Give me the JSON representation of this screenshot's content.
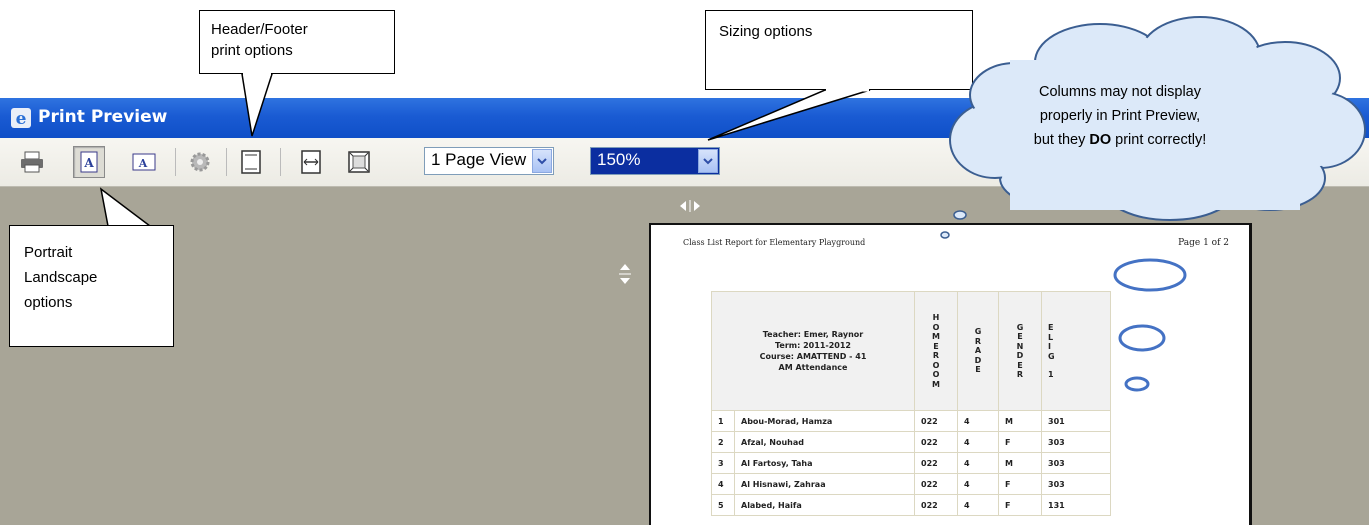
{
  "window": {
    "title": "Print Preview"
  },
  "toolbar": {
    "page_view_select": "1 Page View",
    "zoom_select": "150%"
  },
  "callouts": {
    "header_footer": [
      "Header/Footer",
      "print options"
    ],
    "sizing": "Sizing options",
    "portrait_landscape": [
      "Portrait",
      "Landscape",
      "options"
    ],
    "cloud": {
      "line1": "Columns may not display",
      "line2": "properly in Print Preview,",
      "line3_pre": "but they ",
      "line3_bold": "DO",
      "line3_post": " print correctly!"
    }
  },
  "report": {
    "title": "Class List Report for Elementary Playground",
    "page": "Page 1 of 2",
    "header": {
      "teacher": "Teacher: Emer, Raynor",
      "term": "Term: 2011-2012",
      "course": "Course: AMATTEND - 41",
      "course_name": "AM Attendance",
      "col_homeroom": "HOMEROOM",
      "col_grade": "GRADE",
      "col_gender": "GENDER",
      "col_elig": "ELIG",
      "col_elig_num": "1"
    },
    "rows": [
      {
        "num": "1",
        "name": "Abou-Morad, Hamza",
        "homeroom": "022",
        "grade": "4",
        "gender": "M",
        "elig": "301"
      },
      {
        "num": "2",
        "name": "Afzal, Nouhad",
        "homeroom": "022",
        "grade": "4",
        "gender": "F",
        "elig": "303"
      },
      {
        "num": "3",
        "name": "Al Fartosy, Taha",
        "homeroom": "022",
        "grade": "4",
        "gender": "M",
        "elig": "303"
      },
      {
        "num": "4",
        "name": "Al Hisnawi, Zahraa",
        "homeroom": "022",
        "grade": "4",
        "gender": "F",
        "elig": "303"
      },
      {
        "num": "5",
        "name": "Alabed, Haifa",
        "homeroom": "022",
        "grade": "4",
        "gender": "F",
        "elig": "131"
      }
    ]
  },
  "colors": {
    "titlebar": "#1a5bd3",
    "preview_bg": "#a8a597",
    "annotation_ellipse": "#4472c4",
    "cloud_fill": "#dce9f9"
  }
}
